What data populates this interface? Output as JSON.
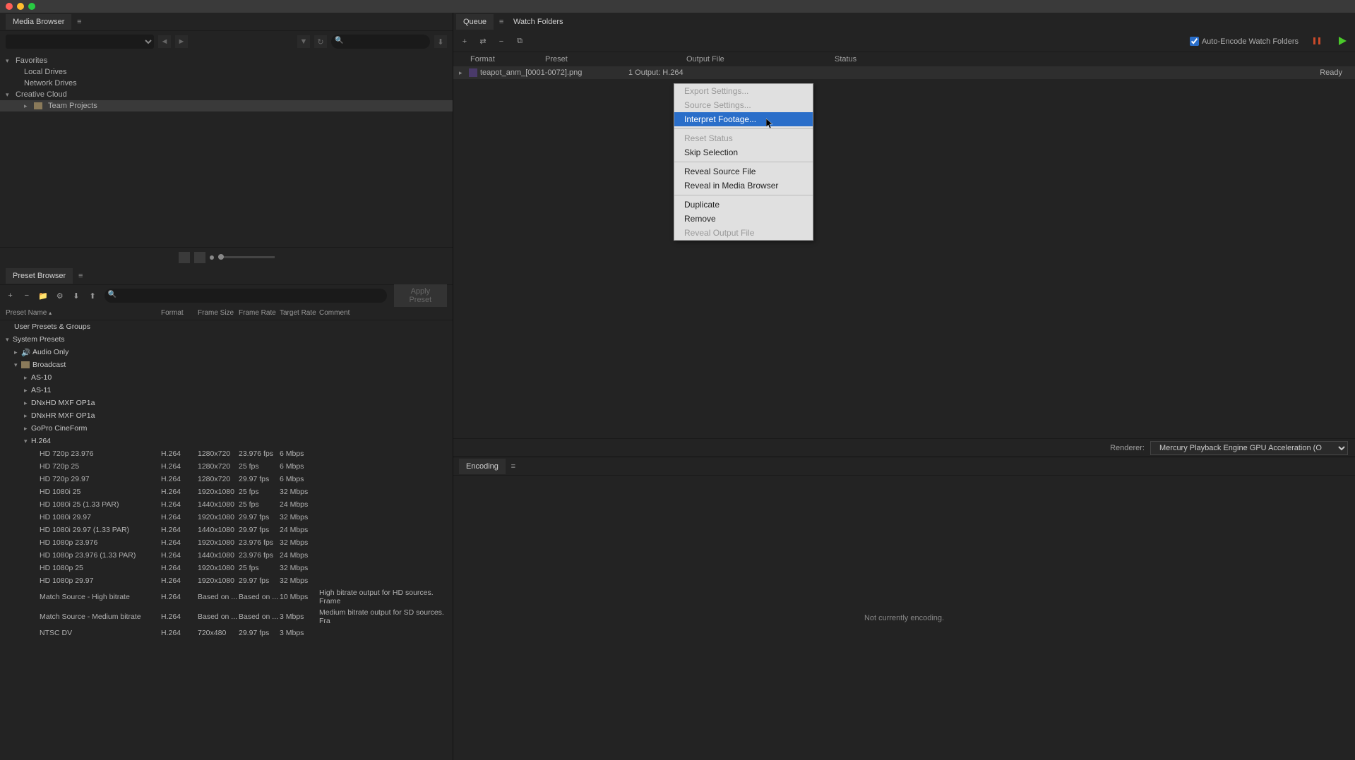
{
  "panels": {
    "mediaBrowser": {
      "title": "Media Browser"
    },
    "presetBrowser": {
      "title": "Preset Browser"
    },
    "queue": {
      "title": "Queue"
    },
    "watchFolders": {
      "title": "Watch Folders"
    },
    "encoding": {
      "title": "Encoding"
    }
  },
  "mediaTree": {
    "favorites": "Favorites",
    "localDrives": "Local Drives",
    "networkDrives": "Network Drives",
    "creativeCloud": "Creative Cloud",
    "teamProjects": "Team Projects"
  },
  "presetHeaders": {
    "name": "Preset Name",
    "format": "Format",
    "frameSize": "Frame Size",
    "frameRate": "Frame Rate",
    "targetRate": "Target Rate",
    "comment": "Comment"
  },
  "presetGroups": {
    "userPresets": "User Presets & Groups",
    "systemPresets": "System Presets",
    "audioOnly": "Audio Only",
    "broadcast": "Broadcast",
    "as10": "AS-10",
    "as11": "AS-11",
    "dnxhdOp1a": "DNxHD MXF OP1a",
    "dnxhrOp1a": "DNxHR MXF OP1a",
    "goproCineform": "GoPro CineForm",
    "h264": "H.264"
  },
  "presets": [
    {
      "name": "HD 720p 23.976",
      "format": "H.264",
      "size": "1280x720",
      "rate": "23.976 fps",
      "target": "6 Mbps",
      "comment": ""
    },
    {
      "name": "HD 720p 25",
      "format": "H.264",
      "size": "1280x720",
      "rate": "25 fps",
      "target": "6 Mbps",
      "comment": ""
    },
    {
      "name": "HD 720p 29.97",
      "format": "H.264",
      "size": "1280x720",
      "rate": "29.97 fps",
      "target": "6 Mbps",
      "comment": ""
    },
    {
      "name": "HD 1080i 25",
      "format": "H.264",
      "size": "1920x1080",
      "rate": "25 fps",
      "target": "32 Mbps",
      "comment": ""
    },
    {
      "name": "HD 1080i 25 (1.33 PAR)",
      "format": "H.264",
      "size": "1440x1080",
      "rate": "25 fps",
      "target": "24 Mbps",
      "comment": ""
    },
    {
      "name": "HD 1080i 29.97",
      "format": "H.264",
      "size": "1920x1080",
      "rate": "29.97 fps",
      "target": "32 Mbps",
      "comment": ""
    },
    {
      "name": "HD 1080i 29.97 (1.33 PAR)",
      "format": "H.264",
      "size": "1440x1080",
      "rate": "29.97 fps",
      "target": "24 Mbps",
      "comment": ""
    },
    {
      "name": "HD 1080p 23.976",
      "format": "H.264",
      "size": "1920x1080",
      "rate": "23.976 fps",
      "target": "32 Mbps",
      "comment": ""
    },
    {
      "name": "HD 1080p 23.976 (1.33 PAR)",
      "format": "H.264",
      "size": "1440x1080",
      "rate": "23.976 fps",
      "target": "24 Mbps",
      "comment": ""
    },
    {
      "name": "HD 1080p 25",
      "format": "H.264",
      "size": "1920x1080",
      "rate": "25 fps",
      "target": "32 Mbps",
      "comment": ""
    },
    {
      "name": "HD 1080p 29.97",
      "format": "H.264",
      "size": "1920x1080",
      "rate": "29.97 fps",
      "target": "32 Mbps",
      "comment": ""
    },
    {
      "name": "Match Source - High bitrate",
      "format": "H.264",
      "size": "Based on ...",
      "rate": "Based on ...",
      "target": "10 Mbps",
      "comment": "High bitrate output for HD sources. Frame"
    },
    {
      "name": "Match Source - Medium bitrate",
      "format": "H.264",
      "size": "Based on ...",
      "rate": "Based on ...",
      "target": "3 Mbps",
      "comment": "Medium bitrate output for SD sources. Fra"
    },
    {
      "name": "NTSC DV",
      "format": "H.264",
      "size": "720x480",
      "rate": "29.97 fps",
      "target": "3 Mbps",
      "comment": ""
    }
  ],
  "applyPresetLabel": "Apply Preset",
  "queueHeaders": {
    "format": "Format",
    "preset": "Preset",
    "output": "Output File",
    "status": "Status"
  },
  "queueItem": {
    "filename": "teapot_anm_[0001-0072].png",
    "output": "1 Output: H.264",
    "status": "Ready"
  },
  "autoEncodeLabel": "Auto-Encode Watch Folders",
  "rendererLabel": "Renderer:",
  "rendererValue": "Mercury Playback Engine GPU Acceleration (OpenCL)",
  "encodingStatus": "Not currently encoding.",
  "contextMenu": {
    "exportSettings": "Export Settings...",
    "sourceSettings": "Source Settings...",
    "interpretFootage": "Interpret Footage...",
    "resetStatus": "Reset Status",
    "skipSelection": "Skip Selection",
    "revealSource": "Reveal Source File",
    "revealMediaBrowser": "Reveal in Media Browser",
    "duplicate": "Duplicate",
    "remove": "Remove",
    "revealOutput": "Reveal Output File"
  }
}
